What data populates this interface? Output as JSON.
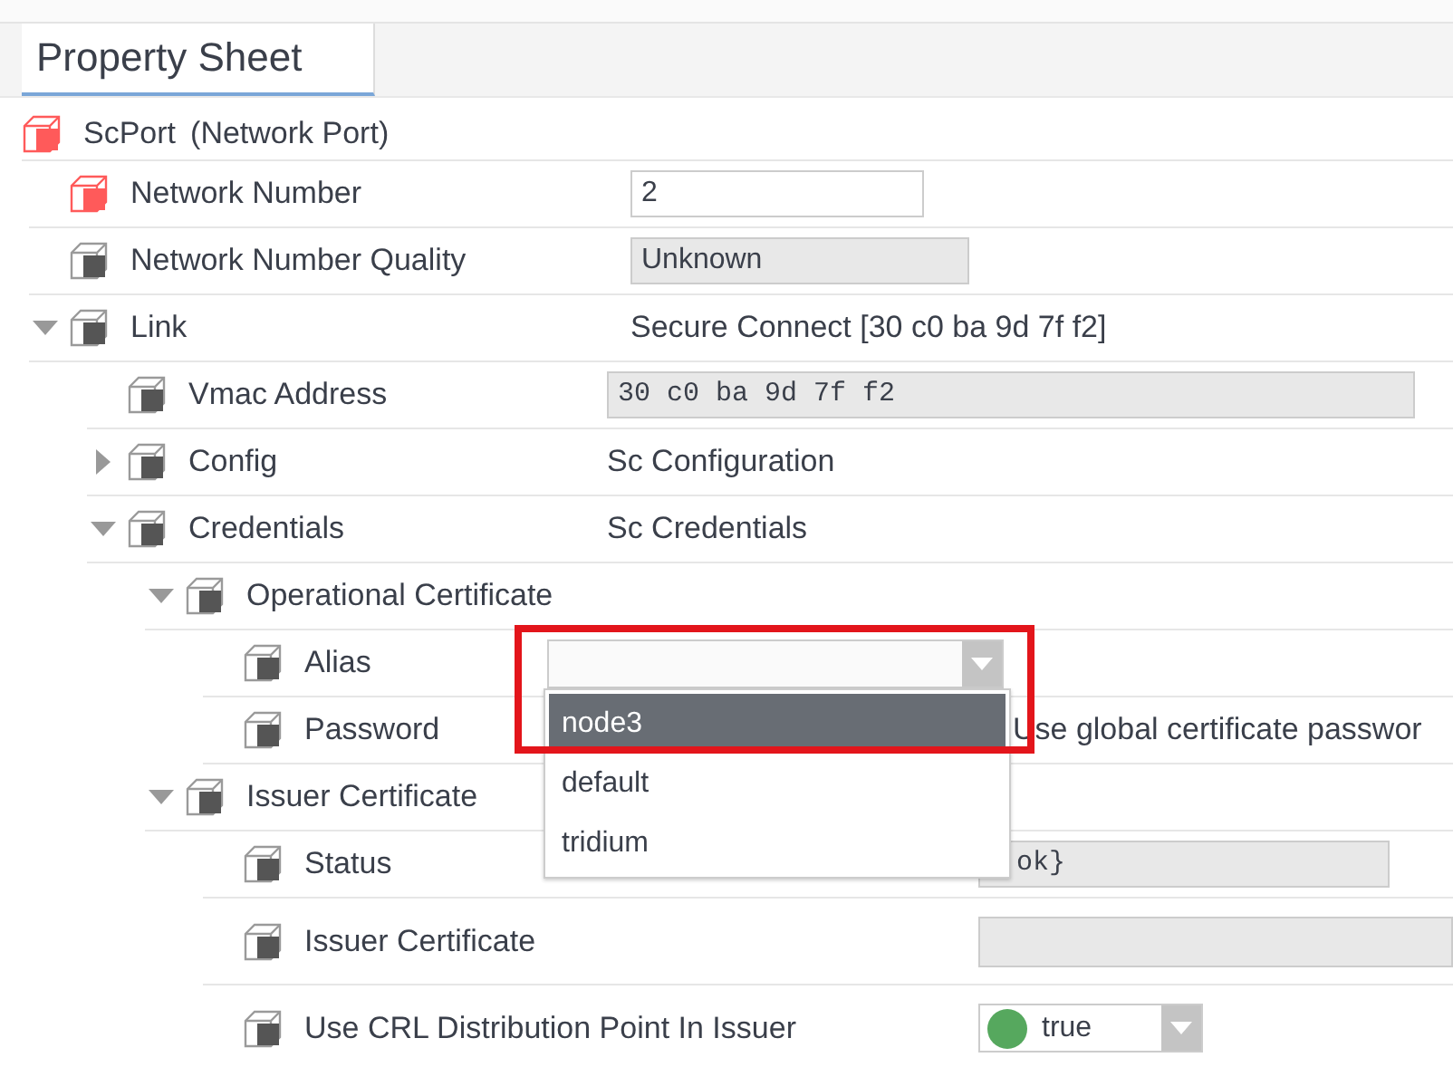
{
  "tabs": [
    {
      "label": "Property Sheet",
      "selected": true
    }
  ],
  "tree": {
    "label": "ScPort",
    "type_label": "(Network Port)",
    "color": "#ff5a5a",
    "children": [
      {
        "label": "Network Number",
        "color": "#ff5a5a",
        "value": {
          "kind": "field",
          "text": "2"
        }
      },
      {
        "label": "Network Number Quality",
        "color": "#555555",
        "value": {
          "kind": "readonly",
          "text": "Unknown"
        }
      },
      {
        "label": "Link",
        "color": "#555555",
        "expanded": true,
        "value": {
          "kind": "text",
          "text": "Secure Connect [30 c0 ba 9d 7f f2]"
        },
        "children": [
          {
            "label": "Vmac Address",
            "color": "#555555",
            "value": {
              "kind": "mono",
              "text": "30 c0 ba 9d 7f f2"
            }
          },
          {
            "label": "Config",
            "color": "#555555",
            "expanded": false,
            "value": {
              "kind": "text",
              "text": "Sc Configuration"
            }
          },
          {
            "label": "Credentials",
            "color": "#555555",
            "expanded": true,
            "value": {
              "kind": "text",
              "text": "Sc Credentials"
            },
            "children": [
              {
                "label": "Operational Certificate",
                "color": "#555555",
                "expanded": true,
                "children": [
                  {
                    "label": "Alias",
                    "color": "#555555",
                    "value": {
                      "kind": "dropdown",
                      "options": [
                        {
                          "label": "node3",
                          "selected": true
                        },
                        {
                          "label": "default",
                          "selected": false
                        },
                        {
                          "label": "tridium",
                          "selected": false
                        }
                      ]
                    }
                  },
                  {
                    "label": "Password",
                    "color": "#555555",
                    "value": {
                      "kind": "text",
                      "text": "Use global certificate passwor"
                    }
                  }
                ]
              },
              {
                "label": "Issuer Certificate",
                "color": "#555555",
                "expanded": true,
                "children": [
                  {
                    "label": "Status",
                    "color": "#555555",
                    "value": {
                      "kind": "mono",
                      "text": "ok}"
                    }
                  },
                  {
                    "label": "Issuer Certificate",
                    "color": "#555555",
                    "value": {
                      "kind": "readonly"
                    }
                  },
                  {
                    "label": "Use CRL Distribution Point In Issuer",
                    "color": "#555555",
                    "value": {
                      "kind": "bool",
                      "text": "true",
                      "color": "#56a85e"
                    }
                  }
                ]
              }
            ]
          }
        ]
      }
    ]
  }
}
